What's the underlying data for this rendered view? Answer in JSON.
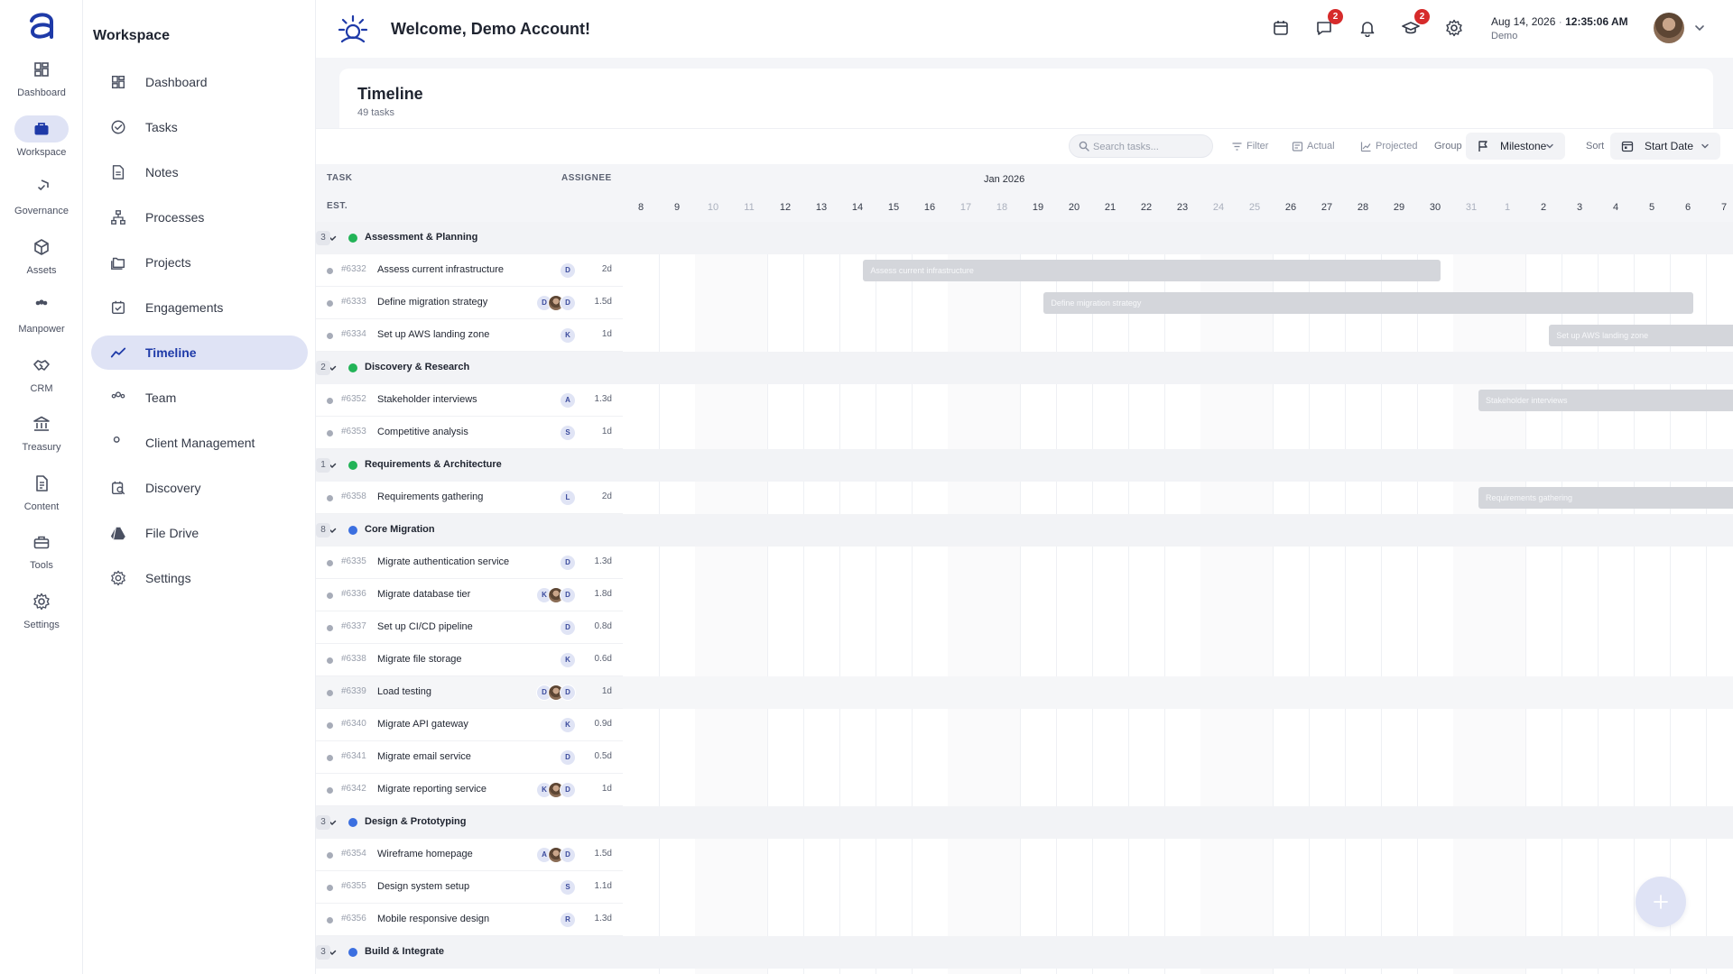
{
  "rail": {
    "items": [
      {
        "label": "Dashboard",
        "icon": "dashboard-icon"
      },
      {
        "label": "Workspace",
        "icon": "briefcase-icon"
      },
      {
        "label": "Governance",
        "icon": "shield-icon"
      },
      {
        "label": "Assets",
        "icon": "cube-icon"
      },
      {
        "label": "Manpower",
        "icon": "people-icon"
      },
      {
        "label": "CRM",
        "icon": "handshake-icon"
      },
      {
        "label": "Treasury",
        "icon": "bank-icon"
      },
      {
        "label": "Content",
        "icon": "document-icon"
      },
      {
        "label": "Tools",
        "icon": "toolbox-icon"
      },
      {
        "label": "Settings",
        "icon": "gear-icon"
      }
    ]
  },
  "sidebar": {
    "title": "Workspace",
    "items": [
      {
        "label": "Dashboard",
        "icon": "dashboard-icon"
      },
      {
        "label": "Tasks",
        "icon": "check-circle-icon"
      },
      {
        "label": "Notes",
        "icon": "note-icon"
      },
      {
        "label": "Processes",
        "icon": "hierarchy-icon"
      },
      {
        "label": "Projects",
        "icon": "folders-icon"
      },
      {
        "label": "Engagements",
        "icon": "calendar-check-icon"
      },
      {
        "label": "Timeline",
        "icon": "trend-icon"
      },
      {
        "label": "Team",
        "icon": "team-icon"
      },
      {
        "label": "Client Management",
        "icon": "client-icon"
      },
      {
        "label": "Discovery",
        "icon": "discovery-icon"
      },
      {
        "label": "File Drive",
        "icon": "drive-icon"
      },
      {
        "label": "Settings",
        "icon": "gear-icon"
      }
    ]
  },
  "header": {
    "welcome": "Welcome, Demo Account!",
    "chat_badge": "2",
    "learning_badge": "2",
    "date": "Aug 14, 2026",
    "time": "12:35:06 AM",
    "user": "Demo"
  },
  "page": {
    "title": "Timeline",
    "count": "49 tasks"
  },
  "toolbar": {
    "search_placeholder": "Search tasks...",
    "filter": "Filter",
    "actual": "Actual",
    "projected": "Projected",
    "group_label": "Group",
    "group_value": "Milestone",
    "sort_label": "Sort",
    "sort_value": "Start Date"
  },
  "table": {
    "col_task": "TASK",
    "col_assignee": "ASSIGNEE",
    "col_est": "EST.",
    "month": "Jan 2026",
    "days": [
      "8",
      "9",
      "10",
      "11",
      "12",
      "13",
      "14",
      "15",
      "16",
      "17",
      "18",
      "19",
      "20",
      "21",
      "22",
      "23",
      "24",
      "25",
      "26",
      "27",
      "28",
      "29",
      "30",
      "31",
      "1",
      "2",
      "3",
      "4",
      "5",
      "6",
      "7"
    ],
    "weekend_days": [
      2,
      3,
      9,
      10,
      16,
      17,
      23,
      24
    ]
  },
  "colors": {
    "accent": "#1e3aa8",
    "group_green": "#22b357",
    "group_blue": "#3b6fe0",
    "badge_red": "#d62b2b",
    "bar_gray": "#d4d6db"
  },
  "groups": [
    {
      "name": "Assessment & Planning",
      "count": "3",
      "color": "#22b357",
      "tasks": [
        {
          "id": "#6332",
          "name": "Assess current infrastructure",
          "assignees": [
            "D"
          ],
          "est": "2d",
          "bar": {
            "start": 6.66,
            "end": 22.64,
            "label": "Assess current infrastructure"
          }
        },
        {
          "id": "#6333",
          "name": "Define migration strategy",
          "assignees": [
            "D",
            "photo",
            "D"
          ],
          "est": "1.5d",
          "bar": {
            "start": 11.66,
            "end": 29.64,
            "label": "Define migration strategy"
          }
        },
        {
          "id": "#6334",
          "name": "Set up AWS landing zone",
          "assignees": [
            "K"
          ],
          "est": "1d",
          "bar": {
            "start": 25.66,
            "end": 31.5,
            "label": "Set up AWS landing zone"
          }
        }
      ]
    },
    {
      "name": "Discovery & Research",
      "count": "2",
      "color": "#22b357",
      "tasks": [
        {
          "id": "#6352",
          "name": "Stakeholder interviews",
          "assignees": [
            "A"
          ],
          "est": "1.3d",
          "bar": {
            "start": 23.7,
            "end": 31.5,
            "label": "Stakeholder interviews"
          }
        },
        {
          "id": "#6353",
          "name": "Competitive analysis",
          "assignees": [
            "S"
          ],
          "est": "1d"
        }
      ]
    },
    {
      "name": "Requirements & Architecture",
      "count": "1",
      "color": "#22b357",
      "tasks": [
        {
          "id": "#6358",
          "name": "Requirements gathering",
          "assignees": [
            "L"
          ],
          "est": "2d",
          "bar": {
            "start": 23.7,
            "end": 31.5,
            "label": "Requirements gathering"
          }
        }
      ]
    },
    {
      "name": "Core Migration",
      "count": "8",
      "color": "#3b6fe0",
      "tasks": [
        {
          "id": "#6335",
          "name": "Migrate authentication service",
          "assignees": [
            "D"
          ],
          "est": "1.3d"
        },
        {
          "id": "#6336",
          "name": "Migrate database tier",
          "assignees": [
            "K",
            "photo",
            "D"
          ],
          "est": "1.8d"
        },
        {
          "id": "#6337",
          "name": "Set up CI/CD pipeline",
          "assignees": [
            "D"
          ],
          "est": "0.8d"
        },
        {
          "id": "#6338",
          "name": "Migrate file storage",
          "assignees": [
            "K"
          ],
          "est": "0.6d"
        },
        {
          "id": "#6339",
          "name": "Load testing",
          "assignees": [
            "D",
            "photo",
            "D"
          ],
          "est": "1d",
          "highlight": true
        },
        {
          "id": "#6340",
          "name": "Migrate API gateway",
          "assignees": [
            "K"
          ],
          "est": "0.9d"
        },
        {
          "id": "#6341",
          "name": "Migrate email service",
          "assignees": [
            "D"
          ],
          "est": "0.5d"
        },
        {
          "id": "#6342",
          "name": "Migrate reporting service",
          "assignees": [
            "K",
            "photo",
            "D"
          ],
          "est": "1d"
        }
      ]
    },
    {
      "name": "Design & Prototyping",
      "count": "3",
      "color": "#3b6fe0",
      "tasks": [
        {
          "id": "#6354",
          "name": "Wireframe homepage",
          "assignees": [
            "A",
            "photo",
            "D"
          ],
          "est": "1.5d"
        },
        {
          "id": "#6355",
          "name": "Design system setup",
          "assignees": [
            "S"
          ],
          "est": "1.1d"
        },
        {
          "id": "#6356",
          "name": "Mobile responsive design",
          "assignees": [
            "R"
          ],
          "est": "1.3d"
        }
      ]
    },
    {
      "name": "Build & Integrate",
      "count": "3",
      "color": "#3b6fe0",
      "tasks": []
    }
  ]
}
